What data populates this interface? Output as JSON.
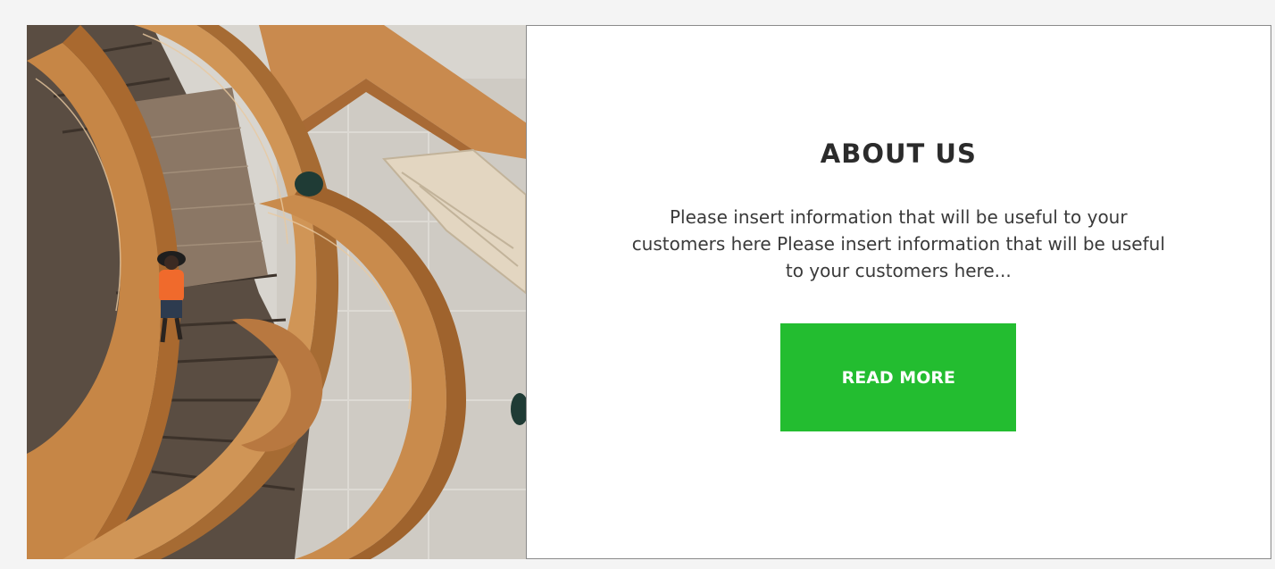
{
  "about": {
    "title": "ABOUT US",
    "description": "Please insert information that will be useful to your customers here Please insert information that will be useful to your customers here...",
    "button_label": "READ MORE"
  },
  "image": {
    "subject": "staircase-photo"
  },
  "colors": {
    "button": "#23bd30",
    "card_border": "#8a8a8a",
    "title": "#2b2b2b"
  }
}
